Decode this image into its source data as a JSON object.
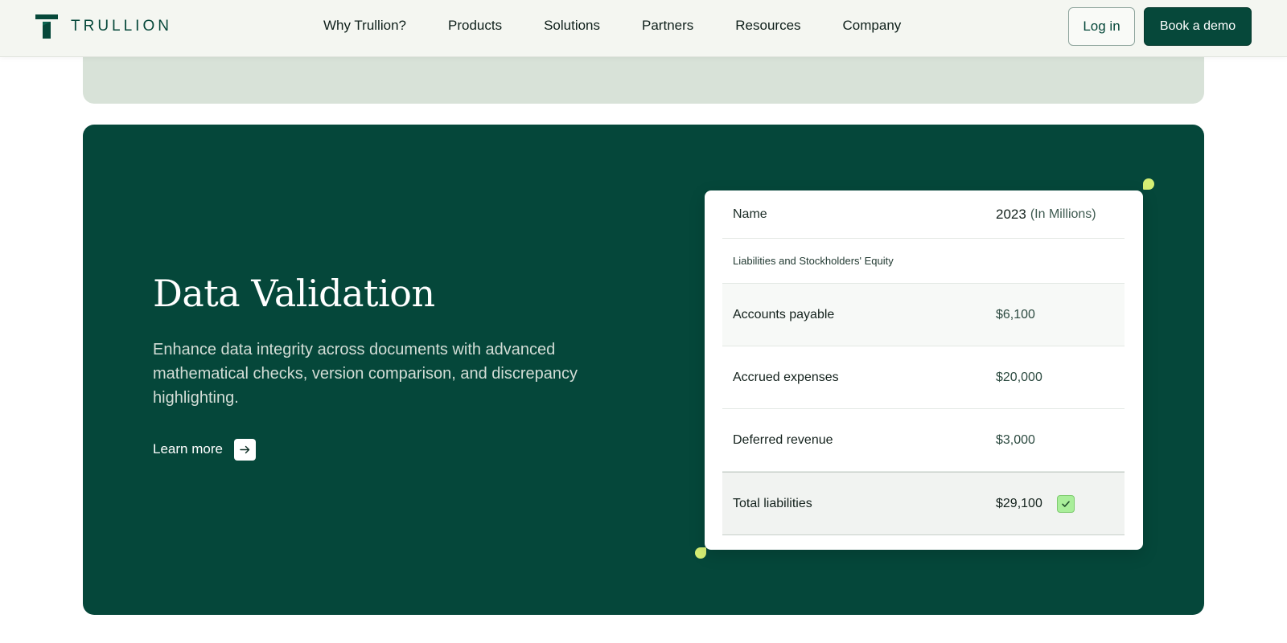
{
  "colors": {
    "brand_green": "#06483a",
    "feature_bg": "#05473a",
    "nav_bg": "#f4f6f1",
    "previous_section_bg": "#d8e2d8",
    "accent_lime": "#d5ef74",
    "check_green": "#a9ee9a"
  },
  "header": {
    "logo_text": "TRULLION",
    "logo_icon": "trullion-t-logo-icon",
    "nav": [
      {
        "label": "Why Trullion?"
      },
      {
        "label": "Products"
      },
      {
        "label": "Solutions"
      },
      {
        "label": "Partners"
      },
      {
        "label": "Resources"
      },
      {
        "label": "Company"
      }
    ],
    "login_label": "Log in",
    "demo_label": "Book a demo"
  },
  "feature": {
    "title": "Data Validation",
    "description": "Enhance data integrity across documents with advanced mathematical checks, version comparison, and discrepancy highlighting.",
    "learn_more_label": "Learn more",
    "learn_more_icon": "arrow-right-icon"
  },
  "table": {
    "header": {
      "name": "Name",
      "year": "2023",
      "unit": "(In Millions)"
    },
    "section_label": "Liabilities and Stockholders' Equity",
    "rows": [
      {
        "name": "Accounts payable",
        "value": "$6,100"
      },
      {
        "name": "Accrued expenses",
        "value": "$20,000"
      },
      {
        "name": "Deferred revenue",
        "value": "$3,000"
      }
    ],
    "total": {
      "name": "Total liabilities",
      "value": "$29,100",
      "validated_icon": "check-icon"
    }
  }
}
